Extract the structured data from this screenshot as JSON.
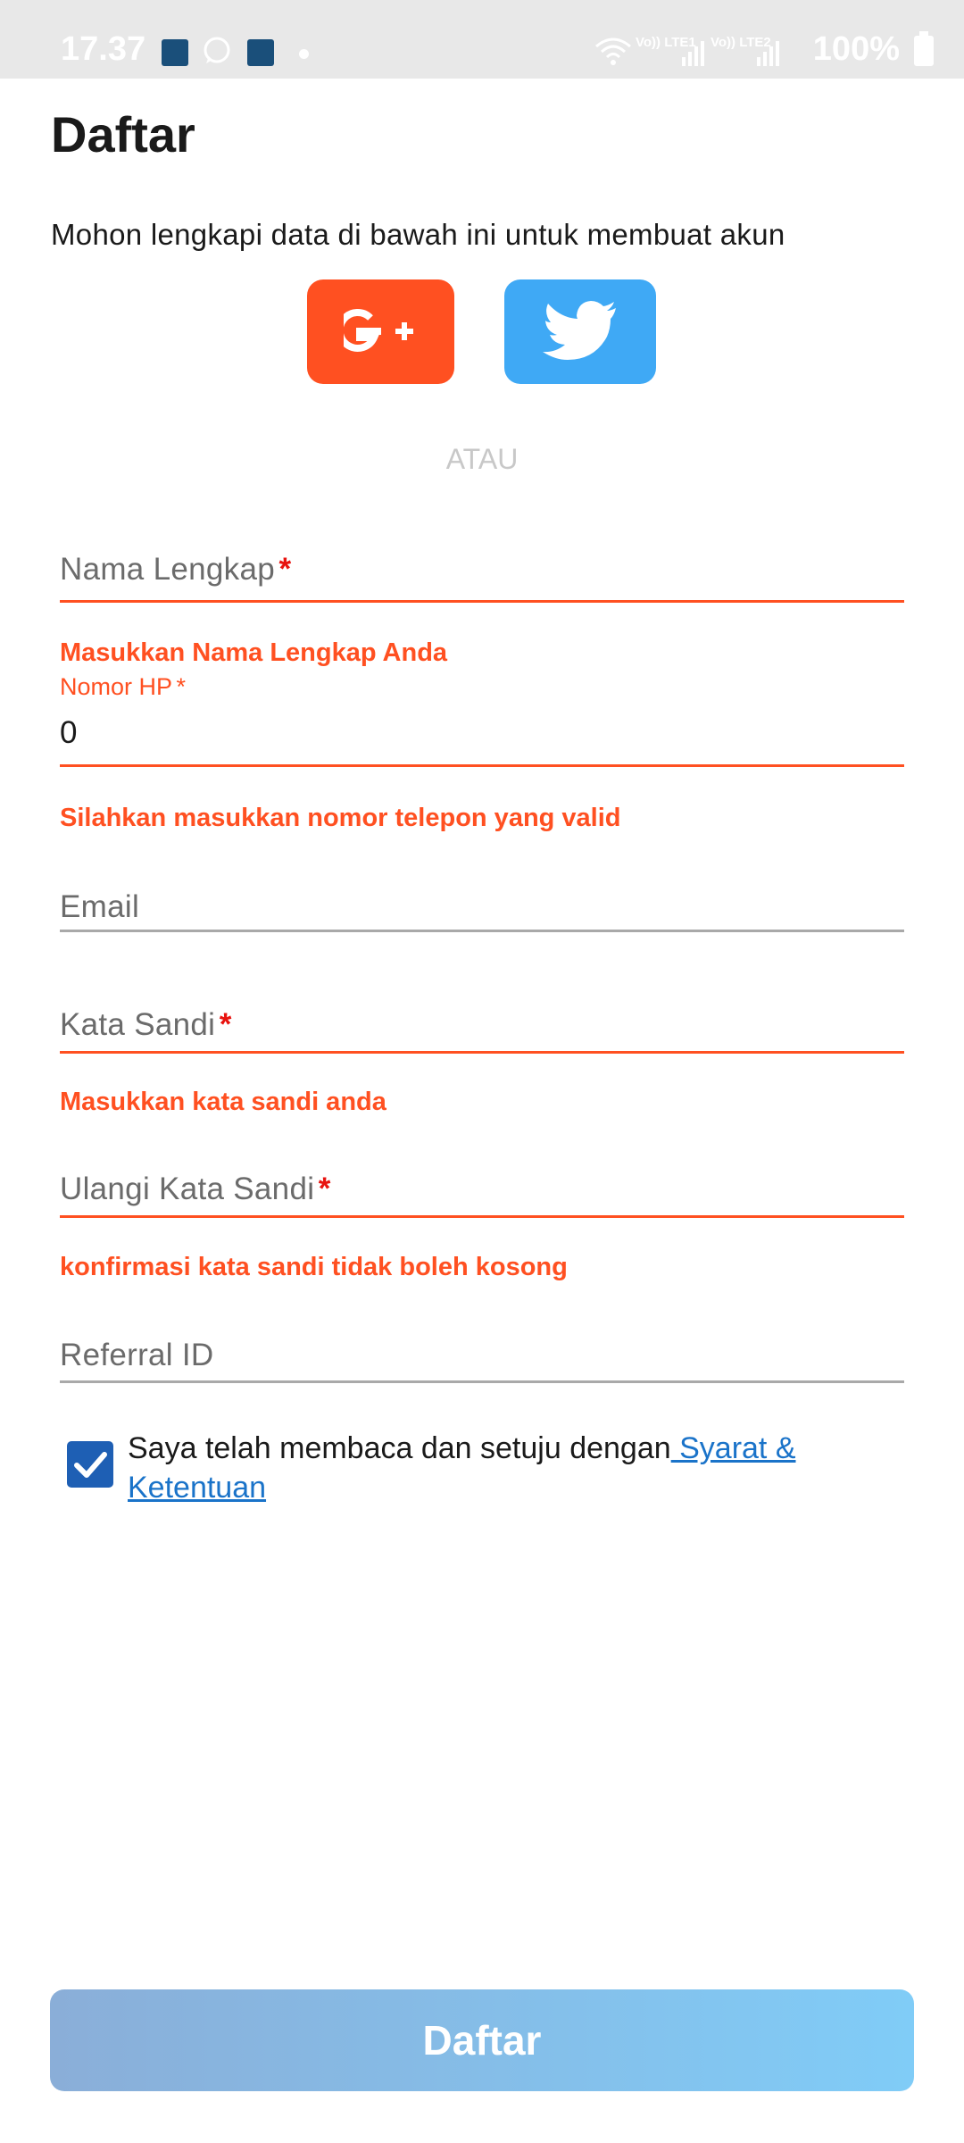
{
  "status_bar": {
    "time": "17.37",
    "battery": "100%",
    "sim1": "Vo)) LTE1",
    "sim2": "Vo)) LTE2"
  },
  "page": {
    "title": "Daftar",
    "subtitle": "Mohon lengkapi data di bawah ini untuk membuat akun",
    "or_label": "ATAU"
  },
  "social": {
    "google_label": "G+",
    "google_color": "#ff5021",
    "twitter_color": "#3fa9f5"
  },
  "form": {
    "full_name": {
      "label": "Nama Lengkap",
      "required_mark": "*",
      "value": "",
      "error": "Masukkan Nama Lengkap Anda"
    },
    "phone": {
      "label": "Nomor HP",
      "required_mark": "*",
      "value": "0",
      "error": "Silahkan masukkan nomor telepon yang valid"
    },
    "email": {
      "label": "Email",
      "value": ""
    },
    "password": {
      "label": "Kata Sandi",
      "required_mark": "*",
      "value": "",
      "error": "Masukkan kata sandi anda"
    },
    "confirm_password": {
      "label": "Ulangi Kata Sandi",
      "required_mark": "*",
      "value": "",
      "error": "konfirmasi kata sandi tidak boleh kosong"
    },
    "referral": {
      "label": "Referral ID",
      "value": ""
    }
  },
  "terms": {
    "checked": true,
    "text": "Saya telah membaca dan setuju dengan",
    "link": " Syarat & Ketentuan"
  },
  "submit_label": "Daftar",
  "colors": {
    "error": "#ff5021",
    "required": "#e8130f",
    "link": "#1a73c9",
    "checkbox": "#1e5fb4"
  }
}
